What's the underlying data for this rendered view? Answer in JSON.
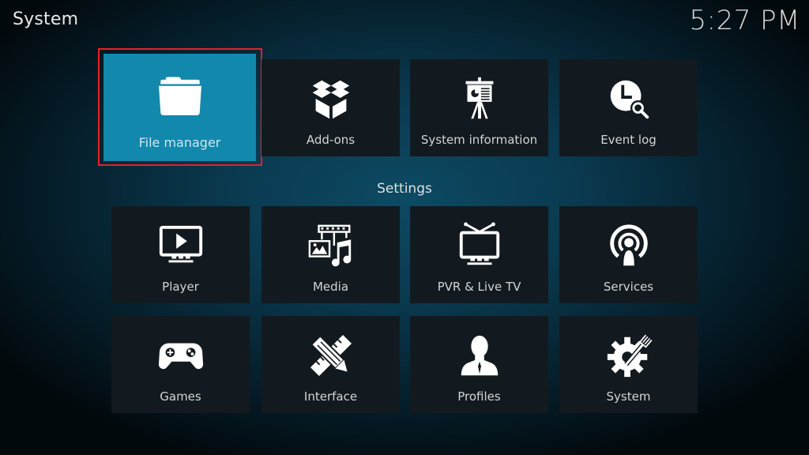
{
  "header": {
    "title": "System",
    "clock": "5:27 PM"
  },
  "top_tiles": [
    {
      "label": "File manager",
      "icon": "folder-icon",
      "focused": true
    },
    {
      "label": "Add-ons",
      "icon": "open-box-icon"
    },
    {
      "label": "System information",
      "icon": "presentation-board-icon"
    },
    {
      "label": "Event log",
      "icon": "clock-search-icon"
    }
  ],
  "settings": {
    "label": "Settings",
    "tiles": [
      {
        "label": "Player",
        "icon": "tv-play-icon"
      },
      {
        "label": "Media",
        "icon": "media-film-image-music-icon"
      },
      {
        "label": "PVR & Live TV",
        "icon": "tv-antenna-icon"
      },
      {
        "label": "Services",
        "icon": "broadcast-icon"
      },
      {
        "label": "Games",
        "icon": "gamepad-icon"
      },
      {
        "label": "Interface",
        "icon": "pencil-ruler-icon"
      },
      {
        "label": "Profiles",
        "icon": "user-profile-icon"
      },
      {
        "label": "System",
        "icon": "gear-wrench-icon"
      }
    ]
  },
  "colors": {
    "focus_tile": "#1288ac",
    "focus_border": "#e3212b",
    "tile_bg": "#121a1f"
  }
}
